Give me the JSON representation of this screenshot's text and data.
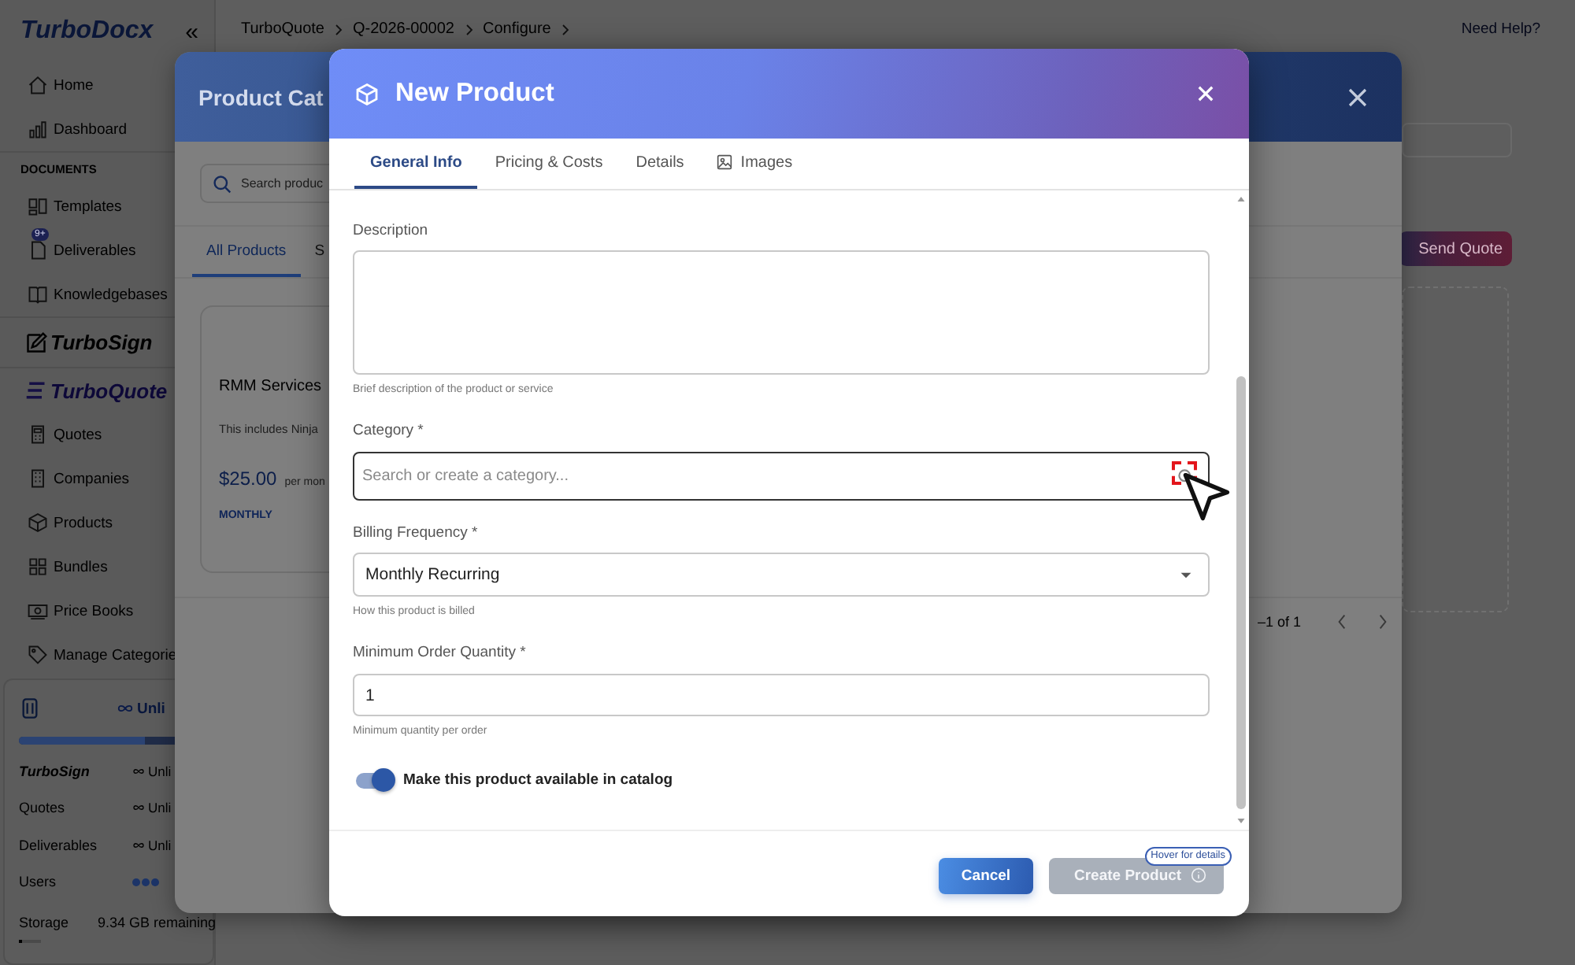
{
  "sidebar": {
    "logo": "TurboDocx",
    "collapse_icon": "«",
    "nav": [
      {
        "kind": "item",
        "label": "Home"
      },
      {
        "kind": "item",
        "label": "Dashboard"
      },
      {
        "kind": "section",
        "label": "DOCUMENTS"
      },
      {
        "kind": "item",
        "label": "Templates"
      },
      {
        "kind": "item",
        "label": "Deliverables",
        "badge": "9+"
      },
      {
        "kind": "item",
        "label": "Knowledgebases"
      },
      {
        "kind": "brand",
        "label": "TurboSign"
      },
      {
        "kind": "brand",
        "label": "TurboQuote"
      },
      {
        "kind": "item",
        "label": "Quotes"
      },
      {
        "kind": "item",
        "label": "Companies"
      },
      {
        "kind": "item",
        "label": "Products"
      },
      {
        "kind": "item",
        "label": "Bundles"
      },
      {
        "kind": "item",
        "label": "Price Books"
      },
      {
        "kind": "item",
        "label": "Manage Categorie"
      }
    ],
    "usage": {
      "header": "Unli",
      "level": 0.7,
      "rows": [
        {
          "kind": "brand",
          "label": "TurboSign",
          "value": "Unli"
        },
        {
          "kind": "text",
          "label": "Quotes",
          "value": "Unli"
        },
        {
          "kind": "text",
          "label": "Deliverables",
          "value": "Unli"
        },
        {
          "kind": "dots",
          "label": "Users"
        },
        {
          "kind": "storage",
          "label": "Storage",
          "value": "9.34 GB remaining",
          "level": 0.12
        }
      ]
    }
  },
  "breadcrumb": [
    "TurboQuote",
    "Q-2026-00002",
    "Configure"
  ],
  "help": "Need Help?",
  "send_button": "Send Quote",
  "catalog": {
    "title": "Product Cat",
    "search_placeholder": "Search produc",
    "tabs": [
      {
        "label": "All Products",
        "selected": true
      },
      {
        "label": "S",
        "selected": false
      }
    ],
    "card": {
      "name": "RMM Services",
      "description": "This includes Ninja",
      "price": "$25.00",
      "per": "per mon",
      "billing": "MONTHLY"
    },
    "pagination": "–1 of 1"
  },
  "dialog": {
    "title": "New Product",
    "tabs": [
      {
        "label": "General Info",
        "selected": true
      },
      {
        "label": "Pricing & Costs",
        "selected": false
      },
      {
        "label": "Details",
        "selected": false
      },
      {
        "label": "Images",
        "selected": false
      }
    ],
    "fields": [
      {
        "kind": "textarea",
        "label": "Description",
        "hint": "Brief description of the product or service"
      },
      {
        "kind": "combobox",
        "label": "Category *",
        "placeholder": "Search or create a category...",
        "focused": true
      },
      {
        "kind": "select",
        "label": "Billing Frequency *",
        "value": "Monthly Recurring",
        "hint": "How this product is billed"
      },
      {
        "kind": "input",
        "label": "Minimum Order Quantity *",
        "value": "1",
        "hint": "Minimum quantity per order"
      }
    ],
    "toggle": {
      "label": "Make this product available in catalog",
      "on": true
    },
    "buttons": [
      {
        "label": "Cancel",
        "kind": "secondary",
        "disabled": false
      },
      {
        "label": "Create Product",
        "kind": "primary",
        "disabled": true
      }
    ],
    "badge": "Hover for details"
  }
}
